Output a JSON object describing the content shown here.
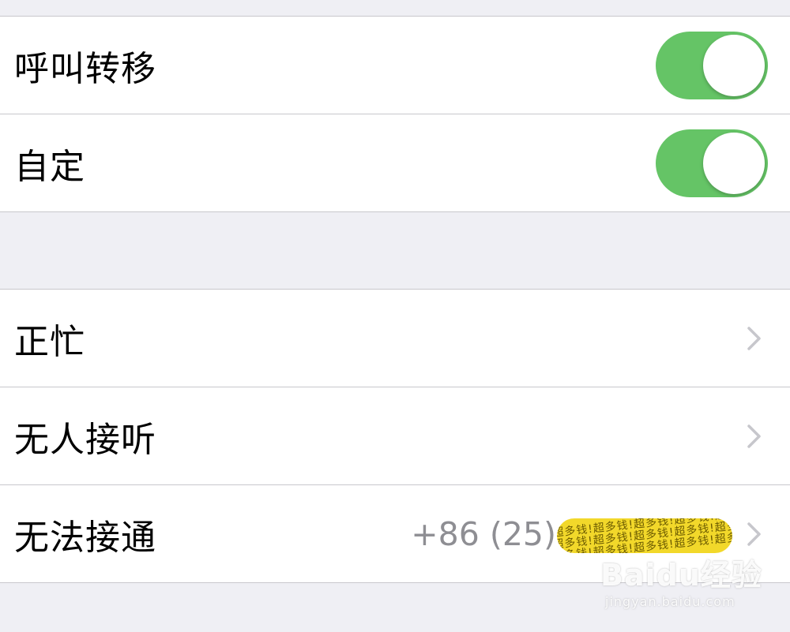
{
  "toggle_group": {
    "items": [
      {
        "label": "呼叫转移",
        "on": true
      },
      {
        "label": "自定",
        "on": true
      }
    ]
  },
  "forward_group": {
    "items": [
      {
        "label": "正忙",
        "value": ""
      },
      {
        "label": "无人接听",
        "value": ""
      },
      {
        "label": "无法接通",
        "value": "+86 (25)"
      }
    ]
  },
  "redaction": {
    "text": "超多钱!超多钱!超多钱!超多钱!超多钱!超多钱!"
  },
  "watermark": {
    "logo": "Baidu经验",
    "url": "jingyan.baidu.com"
  },
  "colors": {
    "toggle_on": "#65c466",
    "background": "#efeff4",
    "separator": "#c8c7cc",
    "secondary_text": "#8e8e93",
    "redaction": "#f2d82a"
  },
  "icons": {
    "disclosure": "chevron-right-icon"
  }
}
